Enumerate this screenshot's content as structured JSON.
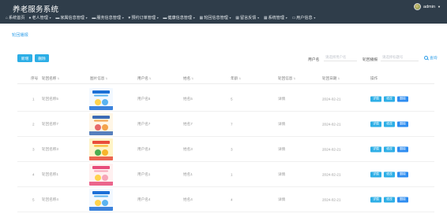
{
  "app": {
    "title": "养老服务系统"
  },
  "user": {
    "name": "admin"
  },
  "nav": [
    {
      "icon": "home-icon",
      "glyph": "⌂",
      "label": "系统首页",
      "arrow": false
    },
    {
      "icon": "user-icon",
      "glyph": "●",
      "label": "老人管理",
      "arrow": true
    },
    {
      "icon": "chat-icon",
      "glyph": "▬",
      "label": "家属信息管理",
      "arrow": true
    },
    {
      "icon": "chat-icon",
      "glyph": "▬",
      "label": "服务信息管理",
      "arrow": true
    },
    {
      "icon": "heart-icon",
      "glyph": "♥",
      "label": "预约订单管理",
      "arrow": true
    },
    {
      "icon": "chat-icon",
      "glyph": "▬",
      "label": "健康信息管理",
      "arrow": true
    },
    {
      "icon": "grid-icon",
      "glyph": "▦",
      "label": "轮回信息管理",
      "arrow": true
    },
    {
      "icon": "grid-icon",
      "glyph": "▦",
      "label": "留言反馈",
      "arrow": true
    },
    {
      "icon": "grid-icon",
      "glyph": "▦",
      "label": "系统管理",
      "arrow": true
    },
    {
      "icon": "folder-icon",
      "glyph": "▭",
      "label": "用户信息",
      "arrow": true
    }
  ],
  "breadcrumb": "轮回播报",
  "toolbar": {
    "add_label": "新增",
    "delete_label": "删除"
  },
  "filters": {
    "username": {
      "label": "用户名",
      "placeholder": "请选择用户名"
    },
    "title": {
      "label": "轮回播报",
      "placeholder": "请选择标题号"
    },
    "search_label": "查询"
  },
  "table": {
    "headers": [
      "序号",
      "轮回名称",
      "图片信息",
      "用户名",
      "姓名",
      "年龄",
      "轮回信息",
      "轮回日期",
      "操作"
    ],
    "rows": [
      {
        "index": "1",
        "name": "轮回名称5",
        "user": "用户名5",
        "realname": "姓名5",
        "age": "5",
        "info": "详情",
        "date": "2024-02-21",
        "thumb": "blue"
      },
      {
        "index": "2",
        "name": "轮回名称7",
        "user": "用户名7",
        "realname": "姓名7",
        "age": "7",
        "info": "详情",
        "date": "2024-02-21",
        "thumb": "clinic"
      },
      {
        "index": "3",
        "name": "轮回名称3",
        "user": "用户名3",
        "realname": "姓名3",
        "age": "3",
        "info": "详情",
        "date": "2024-02-21",
        "thumb": "yellow"
      },
      {
        "index": "4",
        "name": "轮回名称1",
        "user": "用户名1",
        "realname": "姓名1",
        "age": "1",
        "info": "详情",
        "date": "2024-02-21",
        "thumb": "pink"
      },
      {
        "index": "5",
        "name": "轮回名称4",
        "user": "用户名4",
        "realname": "姓名4",
        "age": "4",
        "info": "详情",
        "date": "2024-02-21",
        "thumb": "blue"
      }
    ],
    "actions": {
      "detail": "详情",
      "edit": "修改",
      "delete": "删除"
    }
  },
  "colors": {
    "header_bg": "#2f3d4a",
    "accent": "#2caee6",
    "link": "#2f9ee8"
  }
}
